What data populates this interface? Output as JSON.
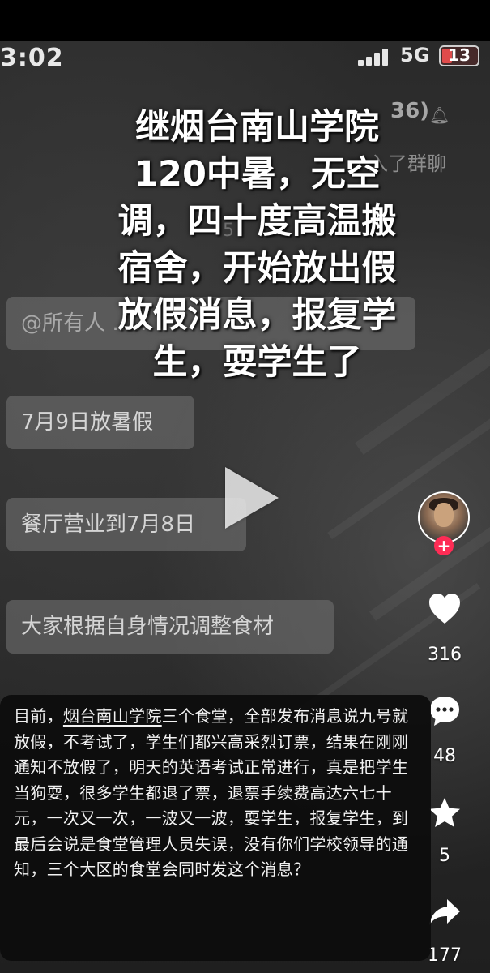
{
  "status_bar": {
    "time": "3:02",
    "network": "5G",
    "battery": "13"
  },
  "background_chat": {
    "group_count": "36)",
    "joined_text": "入了群聊",
    "faint_number": "5",
    "messages": [
      "@所有人 ……",
      "7月9日放暑假",
      "餐厅营业到7月8日",
      "大家根据自身情况调整食材"
    ]
  },
  "headline": {
    "lines": [
      "继烟台南山学院",
      "120中暑，无空",
      "调，四十度高温搬",
      "宿舍，开始放出假",
      "放假消息，报复学",
      "生，耍学生了"
    ]
  },
  "actions": {
    "likes": "316",
    "comments": "48",
    "favorites": "5",
    "shares": "177"
  },
  "description": {
    "prefix": "目前，",
    "underlined": "烟台南山学院",
    "body": "三个食堂，全部发布消息说九号就放假，不考试了，学生们都兴高采烈订票，结果在刚刚通知不放假了，明天的英语考试正常进行，真是把学生当狗耍，很多学生都退了票，退票手续费高达六七十元，一次又一次，一波又一波，耍学生，报复学生，到最后会说是食堂管理人员失误，没有你们学校领导的通知，三个大区的食堂会同时发这个消息？"
  },
  "colors": {
    "follow_badge": "#fe2c55",
    "card_background": "#0c0c0c"
  },
  "icons": [
    "heart-icon",
    "comment-icon",
    "star-icon",
    "share-icon",
    "play-icon",
    "plus-icon",
    "bell-icon"
  ]
}
